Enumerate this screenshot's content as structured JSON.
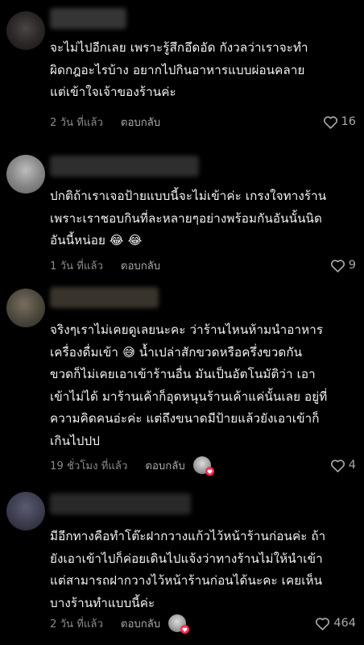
{
  "comments": [
    {
      "text": "จะไม่ไปอีกเลย เพราะรู้สึกอึดอัด กังวลว่าเราจะทำ\nผิดกฎอะไรบ้าง อยากไปกินอาหารแบบผ่อนคลาย\nแต่เข้าใจเจ้าของร้านค่ะ",
      "time": "2 วัน ที่แล้ว",
      "reply": "ตอบกลับ",
      "likes": "16"
    },
    {
      "text": "ปกติถ้าเราเจอป้ายแบบนี้จะไม่เข้าค่ะ เกรงใจทางร้าน\nเพราะเราชอบกินที่ละหลายๆอย่างพร้อมกันอันนั้นนิด\nอันนี้หน่อย 😂 😂",
      "time": "1 วัน ที่แล้ว",
      "reply": "ตอบกลับ",
      "likes": "9"
    },
    {
      "text": "จริงๆเราไม่เคยดูเลยนะคะ ว่าร้านไหนห้ามนำอาหาร\nเครื่องดื่มเข้า 😅 น้ำเปล่าสักขวดหรือครึ่งขวดกัน\nขวดก็ไม่เคยเอาเข้าร้านอื่น มันเป็นอัตโนมัติว่า เอา\nเข้าไม่ได้ มาร้านเค้าก็อุดหนุนร้านเค้าแค่นั้นเลย อยู่ที่\nความคิดคนอ่ะค่ะ แต่ถึงขนาดมีป้ายแล้วยังเอาเข้าก็\nเกินไปปป",
      "time": "19 ชั่วโมง ที่แล้ว",
      "reply": "ตอบกลับ",
      "likes": "4"
    },
    {
      "text": "มีอีกทางคือทำโต๊ะฝากวางแก้วไว้หน้าร้านก่อนค่ะ ถ้า\nยังเอาเข้าไปก็ค่อยเดินไปแจ้งว่าทางร้านไม่ให้นำเข้า\nแต่สามารถฝากวางไว้หน้าร้านก่อนได้นะคะ เคยเห็น\nบางร้านทำแบบนี้ค่ะ",
      "time": "2 วัน ที่แล้ว",
      "reply": "ตอบกลับ",
      "likes": "464"
    }
  ],
  "icons": {
    "like": "heart-outline-icon",
    "creator_like": "heart-badge-icon"
  },
  "colors": {
    "background": "#000000",
    "text": "#f2f2f2",
    "meta": "#8a8a8a",
    "creator_heart": "#fe2c55"
  }
}
